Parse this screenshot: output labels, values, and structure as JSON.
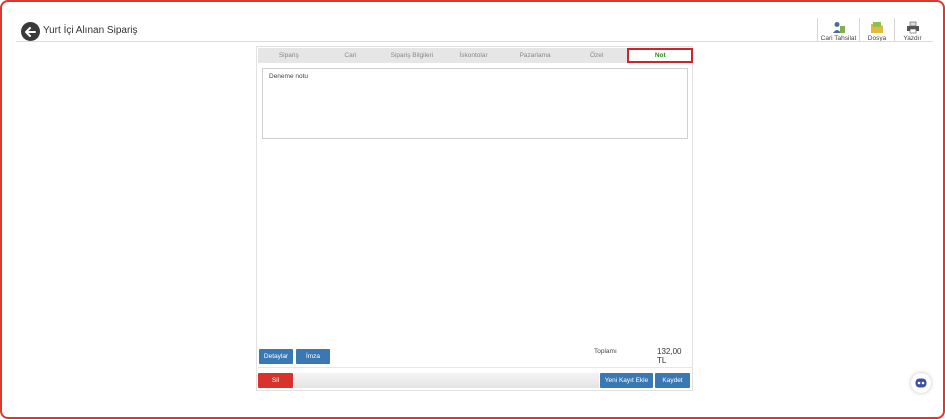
{
  "header": {
    "title": "Yurt İçi Alınan Sipariş"
  },
  "toolbar": {
    "cari_tahsilat": "Cari Tahsilat",
    "dosya": "Dosya",
    "yazdir": "Yazdır"
  },
  "tabs": [
    {
      "label": "Sipariş"
    },
    {
      "label": "Cari"
    },
    {
      "label": "Sipariş Bilgileri"
    },
    {
      "label": "İskontolar"
    },
    {
      "label": "Pazarlama"
    },
    {
      "label": "Özel"
    },
    {
      "label": "Not"
    }
  ],
  "active_tab": "Not",
  "note": {
    "value": "Deneme notu"
  },
  "buttons": {
    "detaylar": "Detaylar",
    "imza": "İmza",
    "sil": "Sil",
    "yeni_kayit_ekle": "Yeni Kayıt Ekle",
    "kaydet": "Kaydet"
  },
  "totals": {
    "label": "Toplamı",
    "value": "132,00 TL"
  },
  "colors": {
    "accent_blue": "#3a78b4",
    "danger_red": "#d9312b",
    "active_tab_text": "#2e8b1e",
    "active_tab_border": "#d0242d"
  }
}
